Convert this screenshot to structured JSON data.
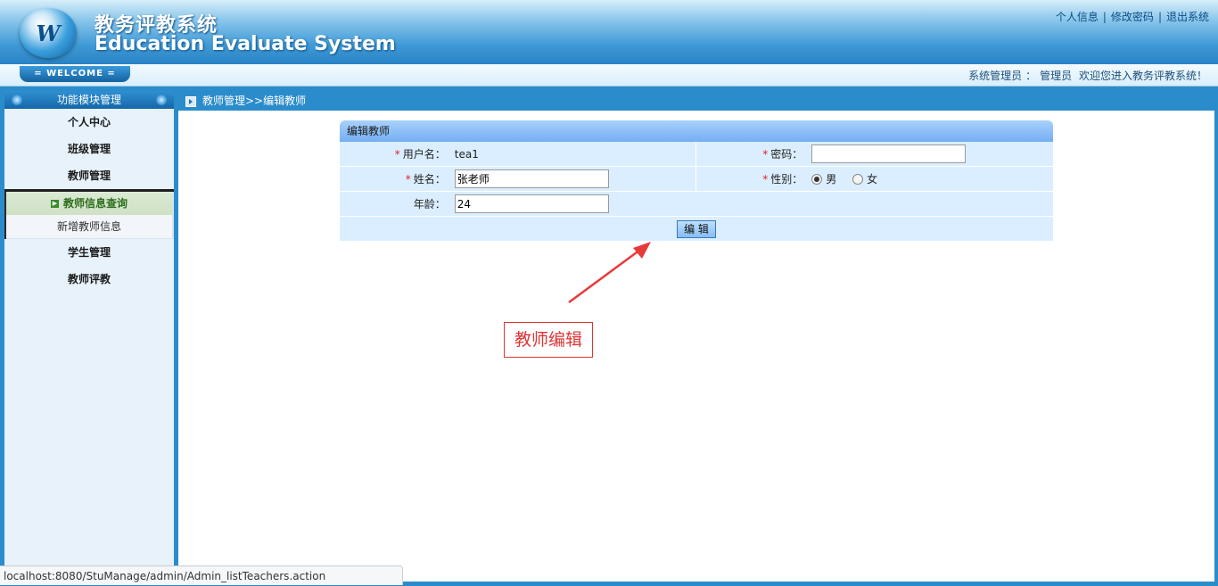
{
  "header": {
    "logo_letter": "W",
    "title_cn": "教务评教系统",
    "title_en": "Education Evaluate System",
    "links": [
      "个人信息",
      "修改密码",
      "退出系统"
    ],
    "link_sep": "|"
  },
  "subbar": {
    "welcome": "= WELCOME =",
    "role": "系统管理员",
    "sep": "：",
    "user": "管理员",
    "greeting": "欢迎您进入教务评教系统！"
  },
  "sidebar": {
    "title": "功能模块管理",
    "items_top": [
      "个人中心",
      "班级管理",
      "教师管理"
    ],
    "sub_active": "教师信息查询",
    "sub_item": "新增教师信息",
    "items_bottom": [
      "学生管理",
      "教师评教"
    ]
  },
  "breadcrumb": "教师管理>>编辑教师",
  "form": {
    "title": "编辑教师",
    "required_mark": "*",
    "username_label": "用户名：",
    "username_value": "tea1",
    "password_label": "密码：",
    "password_value": "",
    "name_label": "姓名：",
    "name_value": "张老师",
    "gender_label": "性别：",
    "gender_options": [
      "男",
      "女"
    ],
    "gender_selected": "男",
    "age_label": "年龄：",
    "age_value": "24",
    "submit_label": "编 辑"
  },
  "annotation": {
    "text": "教师编辑",
    "color": "#e03434"
  },
  "statusbar": "localhost:8080/StuManage/admin/Admin_listTeachers.action",
  "colors": {
    "header_blue": "#2a82c4",
    "panel_bg": "#dbeeff",
    "accent_green": "#2d6e1c"
  }
}
